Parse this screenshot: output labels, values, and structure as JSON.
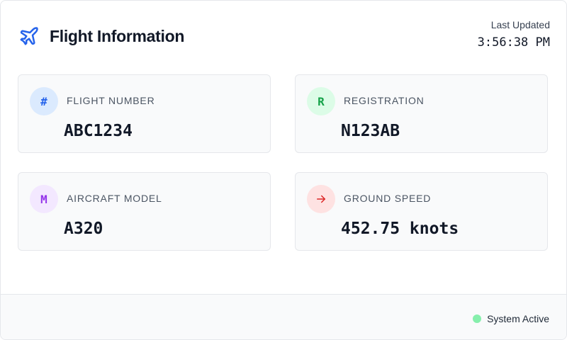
{
  "header": {
    "title": "Flight Information",
    "icon": "airplane-icon",
    "last_updated_label": "Last Updated",
    "last_updated_time": "3:56:38 PM"
  },
  "cards": [
    {
      "badge": "#",
      "icon": "hash-icon",
      "label": "Flight Number",
      "value": "ABC1234",
      "accent": "#2563eb",
      "badge_bg": "#dbeafe"
    },
    {
      "badge": "R",
      "icon": "registration-icon",
      "label": "Registration",
      "value": "N123AB",
      "accent": "#16a34a",
      "badge_bg": "#dcfce7"
    },
    {
      "badge": "M",
      "icon": "model-icon",
      "label": "Aircraft Model",
      "value": "A320",
      "accent": "#9333ea",
      "badge_bg": "#f3e8ff"
    },
    {
      "badge": "→",
      "icon": "arrow-right-icon",
      "label": "Ground Speed",
      "value": "452.75 knots",
      "accent": "#dc2626",
      "badge_bg": "#fee2e2"
    }
  ],
  "footer": {
    "status_text": "System Active",
    "status_color": "#86efac"
  },
  "colors": {
    "brand": "#2563eb"
  }
}
